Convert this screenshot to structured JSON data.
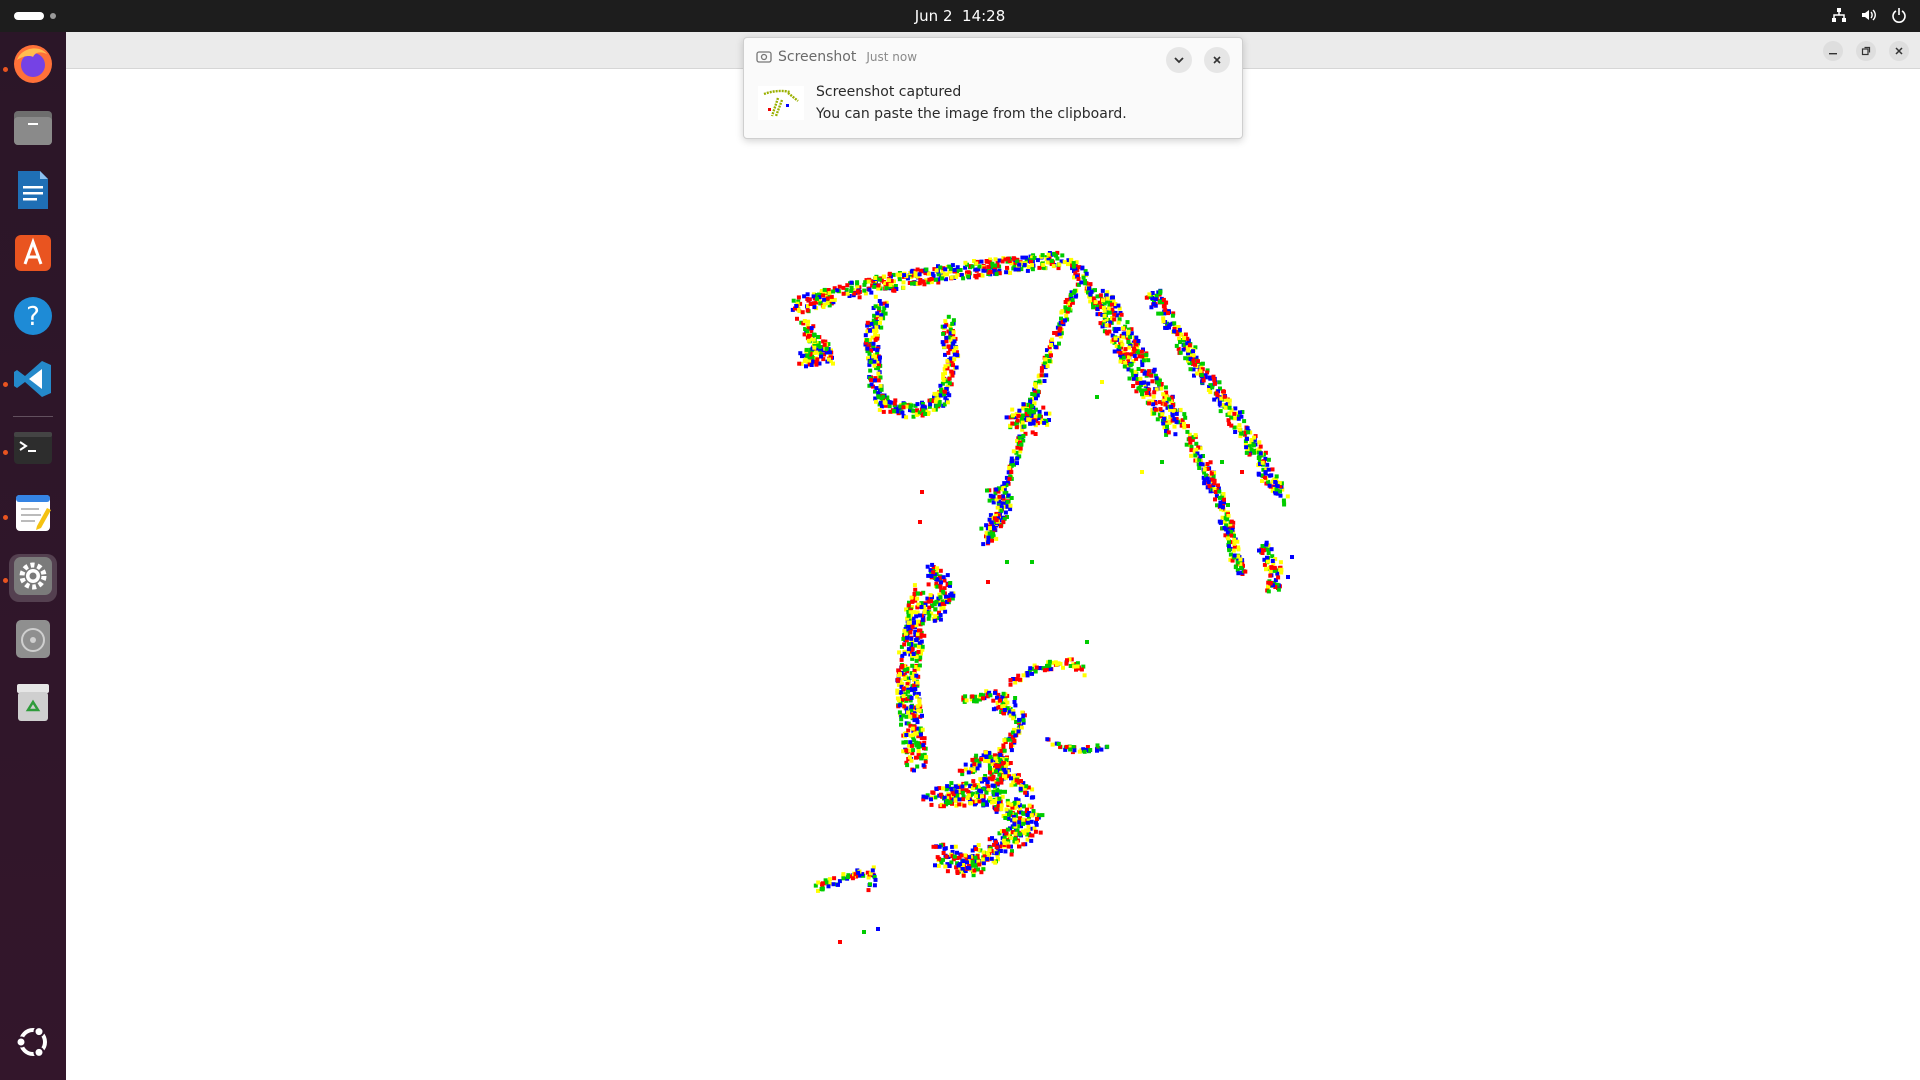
{
  "topbar": {
    "date": "Jun 2",
    "time": "14:28",
    "icons": [
      "network-icon",
      "volume-icon",
      "power-icon"
    ]
  },
  "dock": {
    "items": [
      {
        "name": "firefox",
        "icon": "firefox-icon",
        "running": true
      },
      {
        "name": "files",
        "icon": "files-icon",
        "running": false
      },
      {
        "name": "libreoffice-writer",
        "icon": "writer-icon",
        "running": false
      },
      {
        "name": "app-center",
        "icon": "app-center-icon",
        "running": false
      },
      {
        "name": "help",
        "icon": "help-icon",
        "running": false
      },
      {
        "name": "vscode",
        "icon": "vscode-icon",
        "running": true
      },
      {
        "name": "terminal",
        "icon": "terminal-icon",
        "running": true
      },
      {
        "name": "text-editor",
        "icon": "text-editor-icon",
        "running": true
      },
      {
        "name": "settings",
        "icon": "settings-icon",
        "running": true,
        "active": true
      },
      {
        "name": "disc",
        "icon": "disc-icon",
        "running": false
      },
      {
        "name": "trash",
        "icon": "trash-icon",
        "running": false
      },
      {
        "name": "show-apps",
        "icon": "ubuntu-logo-icon",
        "running": false
      }
    ],
    "accent": "#e95420"
  },
  "notification": {
    "app_name": "Screenshot",
    "time": "Just now",
    "title": "Screenshot captured",
    "body": "You can paste the image from the clipboard."
  },
  "plot": {
    "palette": [
      "#ff0000",
      "#00cc00",
      "#0000ff",
      "#ffff00"
    ]
  }
}
